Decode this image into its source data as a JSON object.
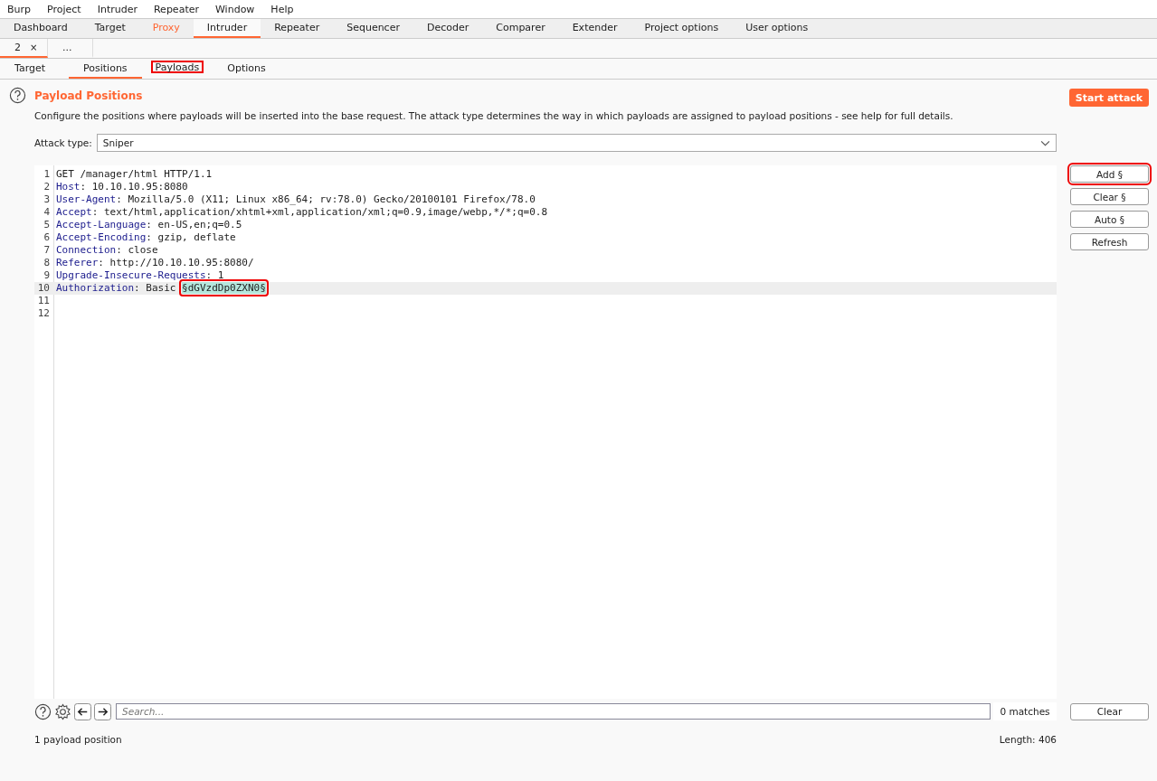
{
  "menu": [
    "Burp",
    "Project",
    "Intruder",
    "Repeater",
    "Window",
    "Help"
  ],
  "main_tabs": [
    {
      "label": "Dashboard",
      "selected": false,
      "highlighted": false
    },
    {
      "label": "Target",
      "selected": false,
      "highlighted": false
    },
    {
      "label": "Proxy",
      "selected": false,
      "highlighted": true
    },
    {
      "label": "Intruder",
      "selected": true,
      "highlighted": false
    },
    {
      "label": "Repeater",
      "selected": false,
      "highlighted": false
    },
    {
      "label": "Sequencer",
      "selected": false,
      "highlighted": false
    },
    {
      "label": "Decoder",
      "selected": false,
      "highlighted": false
    },
    {
      "label": "Comparer",
      "selected": false,
      "highlighted": false
    },
    {
      "label": "Extender",
      "selected": false,
      "highlighted": false
    },
    {
      "label": "Project options",
      "selected": false,
      "highlighted": false
    },
    {
      "label": "User options",
      "selected": false,
      "highlighted": false
    }
  ],
  "attack_tabs": [
    {
      "label": "2",
      "close": "×",
      "selected": true
    },
    {
      "label": "...",
      "selected": false
    }
  ],
  "sub_tabs": [
    {
      "label": "Target",
      "selected": false,
      "annotated": false
    },
    {
      "label": "Positions",
      "selected": true,
      "annotated": false
    },
    {
      "label": "Payloads",
      "selected": false,
      "annotated": true
    },
    {
      "label": "Options",
      "selected": false,
      "annotated": false
    }
  ],
  "section": {
    "title": "Payload Positions",
    "description": "Configure the positions where payloads will be inserted into the base request. The attack type determines the way in which payloads are assigned to payload positions - see help for full details.",
    "start_button": "Start attack"
  },
  "attack_type": {
    "label": "Attack type:",
    "value": "Sniper"
  },
  "request_lines": [
    {
      "number": "1",
      "text": "GET /manager/html HTTP/1.1",
      "current": false
    },
    {
      "number": "2",
      "name": "Host",
      "text": ": 10.10.10.95:8080",
      "current": false
    },
    {
      "number": "3",
      "name": "User-Agent",
      "text": ": Mozilla/5.0 (X11; Linux x86_64; rv:78.0) Gecko/20100101 Firefox/78.0",
      "current": false
    },
    {
      "number": "4",
      "name": "Accept",
      "text": ": text/html,application/xhtml+xml,application/xml;q=0.9,image/webp,*/*;q=0.8",
      "current": false
    },
    {
      "number": "5",
      "name": "Accept-Language",
      "text": ": en-US,en;q=0.5",
      "current": false
    },
    {
      "number": "6",
      "name": "Accept-Encoding",
      "text": ": gzip, deflate",
      "current": false
    },
    {
      "number": "7",
      "name": "Connection",
      "text": ": close",
      "current": false
    },
    {
      "number": "8",
      "name": "Referer",
      "text": ": http://10.10.10.95:8080/",
      "current": false
    },
    {
      "number": "9",
      "name": "Upgrade-Insecure-Requests",
      "text": ": 1",
      "current": false
    },
    {
      "number": "10",
      "name": "Authorization",
      "text": ": Basic ",
      "payload": "§dGVzdDp0ZXN0§",
      "annotated": true,
      "current": true
    },
    {
      "number": "11",
      "current": false
    },
    {
      "number": "12",
      "current": false
    }
  ],
  "side_buttons": [
    {
      "label": "Add §",
      "annotated": true
    },
    {
      "label": "Clear §",
      "annotated": false
    },
    {
      "label": "Auto §",
      "annotated": false
    },
    {
      "label": "Refresh",
      "annotated": false
    }
  ],
  "search": {
    "placeholder": "Search...",
    "matches": "0 matches",
    "clear_button": "Clear"
  },
  "status": {
    "positions": "1 payload position",
    "length": "Length: 406"
  }
}
